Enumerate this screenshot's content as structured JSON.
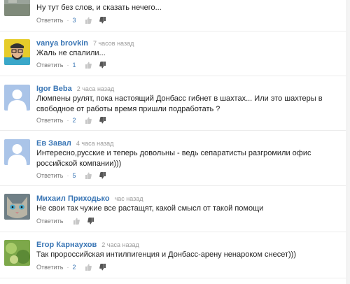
{
  "comments": [
    {
      "author": "",
      "time": "",
      "text": "Ну тут без слов, и сказать нечего...",
      "reply_label": "Ответить",
      "likes": "3",
      "avatar": "gray-landscape-avatar"
    },
    {
      "author": "vanya brovkin",
      "time": "7 часов назад",
      "text": "Жаль не спалили...",
      "reply_label": "Ответить",
      "likes": "1",
      "avatar": "bearded-man-avatar"
    },
    {
      "author": "Igor Beba",
      "time": "2 часа назад",
      "text": "Люмпены рулят, пока настоящий Донбасс гибнет в шахтах... Или это шахтеры в свободное от работы время пришли подработать ?",
      "reply_label": "Ответить",
      "likes": "2",
      "avatar": "default-user-avatar"
    },
    {
      "author": "Ев Завал",
      "time": "4 часа назад",
      "text": "Интересно,русские и теперь довольны - ведь сепаратисты разгромили офис российской компании)))",
      "reply_label": "Ответить",
      "likes": "5",
      "avatar": "default-user-avatar"
    },
    {
      "author": "Михаил Приходько",
      "time": "час назад",
      "text": "Не свои так чужие все растащят, какой смысл от такой помощи",
      "reply_label": "Ответить",
      "likes": "",
      "avatar": "cat-avatar"
    },
    {
      "author": "Егор Карнаухов",
      "time": "2 часа назад",
      "text": "Так пророссийская интилпигенция и Донбасс-арену ненароком снесет)))",
      "reply_label": "Ответить",
      "likes": "2",
      "avatar": "green-nature-avatar"
    }
  ],
  "colors": {
    "author": "#3a76b5",
    "count": "#3a76b5",
    "default_avatar_bg": "#aac4e8"
  }
}
